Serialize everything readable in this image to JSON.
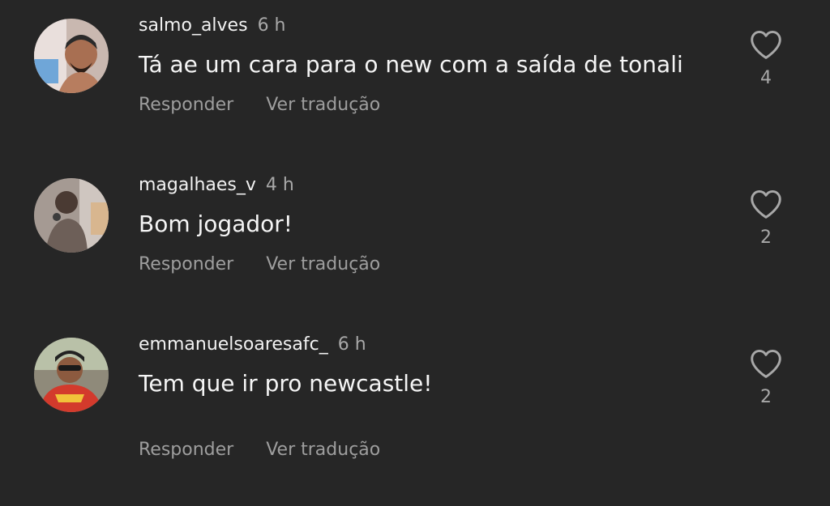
{
  "comments": [
    {
      "username": "salmo_alves",
      "time": "6 h",
      "text": "Tá ae um cara para o new com a saída de tonali",
      "reply_label": "Responder",
      "translate_label": "Ver tradução",
      "likes": "4"
    },
    {
      "username": "magalhaes_v",
      "time": "4 h",
      "text": "Bom jogador!",
      "reply_label": "Responder",
      "translate_label": "Ver tradução",
      "likes": "2"
    },
    {
      "username": "emmanuelsoaresafc_",
      "time": "6 h",
      "text": "Tem que ir pro newcastle!",
      "reply_label": "Responder",
      "translate_label": "Ver tradução",
      "likes": "2"
    }
  ],
  "icons": {
    "like": "heart-outline-icon"
  },
  "colors": {
    "background": "#262626",
    "primary_text": "#f5f5f5",
    "secondary_text": "#a8a8a8"
  }
}
